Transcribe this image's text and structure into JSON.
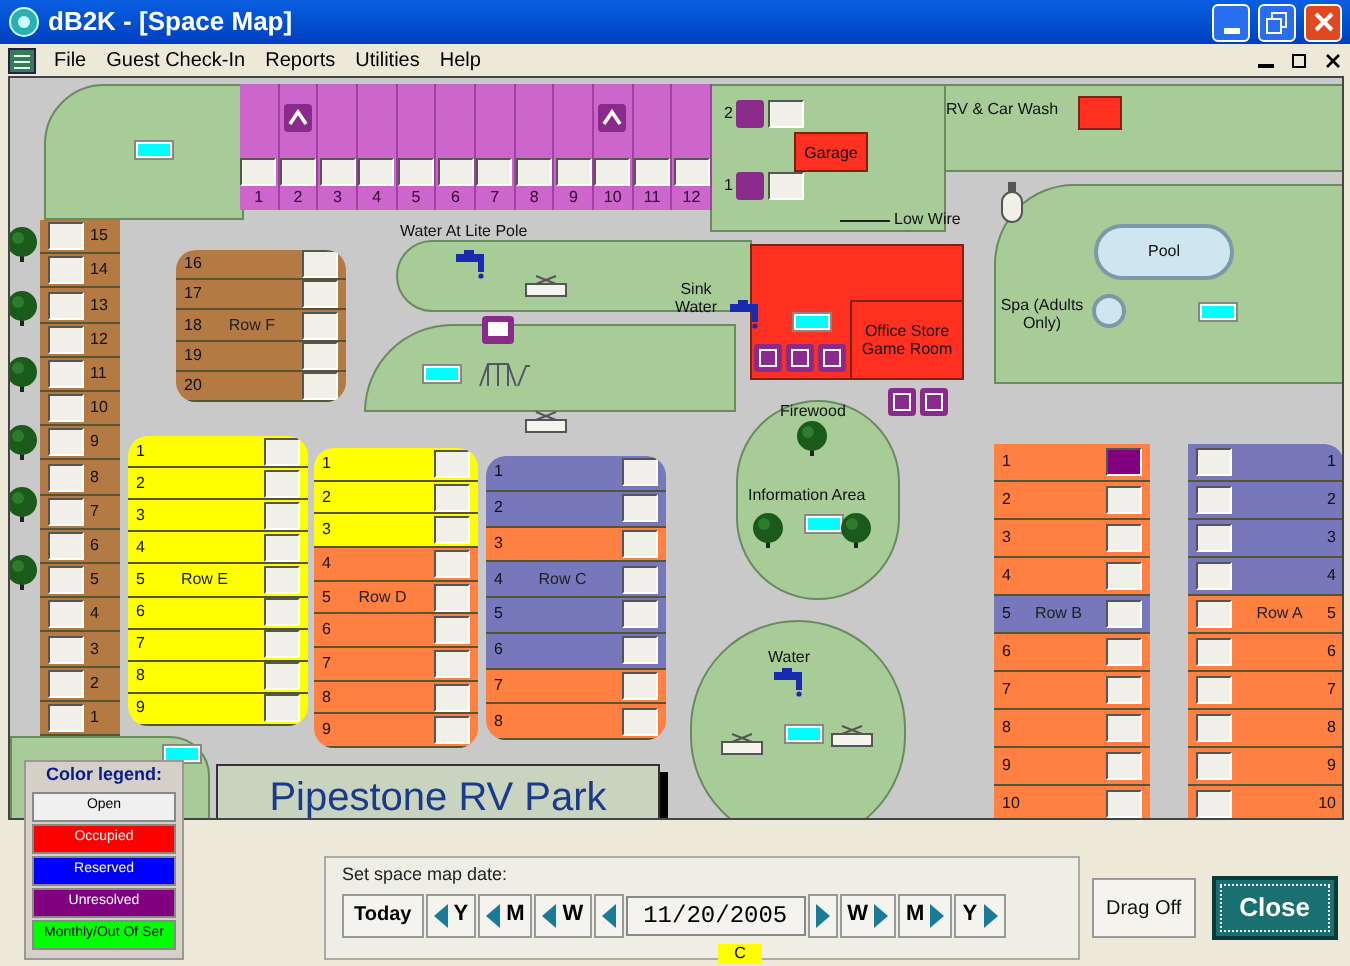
{
  "window": {
    "title": "dB2K - [Space Map]"
  },
  "menu": [
    "File",
    "Guest Check-In",
    "Reports",
    "Utilities",
    "Help"
  ],
  "map": {
    "rows": [
      {
        "kind": "top",
        "sites": [
          {
            "number": "1",
            "color": "#cc66cc"
          },
          {
            "number": "2",
            "color": "#cc66cc"
          },
          {
            "number": "3",
            "color": "#cc66cc"
          },
          {
            "number": "4",
            "color": "#cc66cc"
          },
          {
            "number": "5",
            "color": "#cc66cc"
          },
          {
            "number": "6",
            "color": "#cc66cc"
          },
          {
            "number": "7",
            "color": "#cc66cc"
          },
          {
            "number": "8",
            "color": "#cc66cc"
          },
          {
            "number": "9",
            "color": "#cc66cc"
          },
          {
            "number": "10",
            "color": "#cc66cc"
          },
          {
            "number": "11",
            "color": "#cc66cc"
          },
          {
            "number": "12",
            "color": "#cc66cc"
          }
        ]
      },
      {
        "kind": "column",
        "sites": [
          {
            "number": "15",
            "color": "#b47a44"
          },
          {
            "number": "14",
            "color": "#b47a44"
          },
          {
            "number": "13",
            "color": "#b47a44"
          },
          {
            "number": "12",
            "color": "#b47a44"
          },
          {
            "number": "11",
            "color": "#b47a44"
          },
          {
            "number": "10",
            "color": "#b47a44"
          },
          {
            "number": "9",
            "color": "#b47a44"
          },
          {
            "number": "8",
            "color": "#b47a44"
          },
          {
            "number": "7",
            "color": "#b47a44"
          },
          {
            "number": "6",
            "color": "#b47a44"
          },
          {
            "number": "5",
            "color": "#b47a44"
          },
          {
            "number": "4",
            "color": "#b47a44"
          },
          {
            "number": "3",
            "color": "#b47a44"
          },
          {
            "number": "2",
            "color": "#b47a44"
          },
          {
            "number": "1",
            "color": "#b47a44"
          }
        ]
      },
      {
        "kind": "row",
        "label": "Row F",
        "sites": [
          {
            "number": "16",
            "color": "#b47a44"
          },
          {
            "number": "17",
            "color": "#b47a44"
          },
          {
            "number": "18",
            "color": "#b47a44"
          },
          {
            "number": "19",
            "color": "#b47a44"
          },
          {
            "number": "20",
            "color": "#b47a44"
          }
        ]
      },
      {
        "kind": "row",
        "label": "Row E",
        "sites": [
          {
            "number": "1",
            "color": "#ffff00"
          },
          {
            "number": "2",
            "color": "#ffff00"
          },
          {
            "number": "3",
            "color": "#ffff00"
          },
          {
            "number": "4",
            "color": "#ffff00"
          },
          {
            "number": "5",
            "color": "#ffff00"
          },
          {
            "number": "6",
            "color": "#ffff00"
          },
          {
            "number": "7",
            "color": "#ffff00"
          },
          {
            "number": "8",
            "color": "#ffff00"
          },
          {
            "number": "9",
            "color": "#ffff00"
          }
        ]
      },
      {
        "kind": "row",
        "label": "Row D",
        "sites": [
          {
            "number": "1",
            "color": "#ffff00"
          },
          {
            "number": "2",
            "color": "#ffff00"
          },
          {
            "number": "3",
            "color": "#ffff00"
          },
          {
            "number": "4",
            "color": "#ff8040"
          },
          {
            "number": "5",
            "color": "#ff8040"
          },
          {
            "number": "6",
            "color": "#ff8040"
          },
          {
            "number": "7",
            "color": "#ff8040"
          },
          {
            "number": "8",
            "color": "#ff8040"
          },
          {
            "number": "9",
            "color": "#ff8040"
          }
        ]
      },
      {
        "kind": "row",
        "label": "Row C",
        "sites": [
          {
            "number": "1",
            "color": "#7777bb"
          },
          {
            "number": "2",
            "color": "#7777bb"
          },
          {
            "number": "3",
            "color": "#ff8040"
          },
          {
            "number": "4",
            "color": "#7777bb"
          },
          {
            "number": "5",
            "color": "#7777bb"
          },
          {
            "number": "6",
            "color": "#7777bb"
          },
          {
            "number": "7",
            "color": "#ff8040"
          },
          {
            "number": "8",
            "color": "#ff8040"
          }
        ]
      },
      {
        "kind": "row",
        "label": "Row B",
        "sites": [
          {
            "number": "1",
            "color": "#ff8040",
            "box": {
              "color": "#800080"
            }
          },
          {
            "number": "2",
            "color": "#ff8040"
          },
          {
            "number": "3",
            "color": "#ff8040"
          },
          {
            "number": "4",
            "color": "#ff8040"
          },
          {
            "number": "5",
            "color": "#7777bb"
          },
          {
            "number": "6",
            "color": "#ff8040"
          },
          {
            "number": "7",
            "color": "#ff8040"
          },
          {
            "number": "8",
            "color": "#ff8040"
          },
          {
            "number": "9",
            "color": "#ff8040"
          },
          {
            "number": "10",
            "color": "#ff8040"
          }
        ]
      },
      {
        "kind": "mirrored",
        "label": "Row A",
        "sites": [
          {
            "number": "1",
            "color": "#7777bb"
          },
          {
            "number": "2",
            "color": "#7777bb"
          },
          {
            "number": "3",
            "color": "#7777bb"
          },
          {
            "number": "4",
            "color": "#7777bb"
          },
          {
            "number": "5",
            "color": "#ff8040"
          },
          {
            "number": "6",
            "color": "#ff8040"
          },
          {
            "number": "7",
            "color": "#ff8040"
          },
          {
            "number": "8",
            "color": "#ff8040"
          },
          {
            "number": "9",
            "color": "#ff8040"
          },
          {
            "number": "10",
            "color": "#ff8040"
          }
        ]
      },
      {
        "kind": "storage",
        "sites": [
          {
            "number": "2"
          },
          {
            "number": "1"
          }
        ]
      }
    ],
    "labels": [
      {
        "kind": "text",
        "text": "Water At Lite Pole"
      },
      {
        "kind": "building",
        "text": "Garage"
      },
      {
        "kind": "text",
        "text": "RV & Car Wash"
      },
      {
        "kind": "text",
        "text": "Low Wire"
      },
      {
        "kind": "text",
        "text": "Sink Water"
      },
      {
        "kind": "building",
        "text": "Office Store Game Room"
      },
      {
        "kind": "pool",
        "text": "Pool"
      },
      {
        "kind": "text",
        "text": "Spa (Adults Only)"
      },
      {
        "kind": "text",
        "text": "Firewood"
      },
      {
        "kind": "text",
        "text": "Information Area"
      },
      {
        "kind": "text",
        "text": "Water"
      }
    ],
    "title": "Pipestone RV Park"
  },
  "legend": {
    "title": "Color legend:",
    "items": [
      {
        "label": "Open",
        "color": "#f0f0f0"
      },
      {
        "label": "Occupied",
        "color": "#ff0000"
      },
      {
        "label": "Reserved",
        "color": "#0000ff"
      },
      {
        "label": "Unresolved",
        "color": "#800080"
      },
      {
        "label": "Monthly/Out Of Ser",
        "color": "#00ff00"
      }
    ]
  },
  "date_nav": {
    "label": "Set space map date:",
    "buttons": [
      {
        "kind": "text",
        "label": "Today"
      },
      {
        "kind": "prev",
        "label": "Y"
      },
      {
        "kind": "prev",
        "label": "M"
      },
      {
        "kind": "prev",
        "label": "W"
      },
      {
        "kind": "prev"
      },
      {
        "kind": "date",
        "value": "11/20/2005"
      },
      {
        "kind": "next"
      },
      {
        "kind": "next",
        "label": "W"
      },
      {
        "kind": "next",
        "label": "M"
      },
      {
        "kind": "next",
        "label": "Y"
      }
    ],
    "marker": "C"
  },
  "buttons": [
    {
      "label": "Drag Off",
      "default": false
    },
    {
      "label": "Close",
      "default": true
    }
  ]
}
